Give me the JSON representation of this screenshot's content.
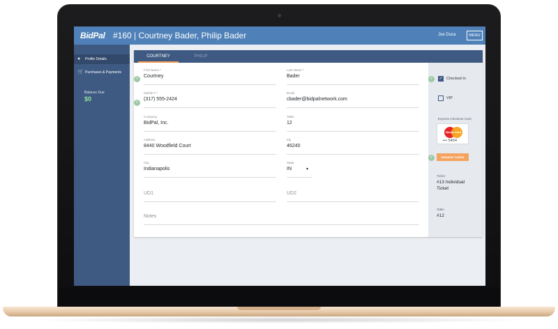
{
  "app": {
    "logo": "BidPal",
    "title": "#160 | Courtney Bader, Philip Bader",
    "user": "Joe Duca",
    "menu_label": "MENU"
  },
  "sidebar": {
    "items": [
      {
        "label": "Profile Details",
        "icon": "person-icon"
      },
      {
        "label": "Purchases & Payments",
        "icon": "cart-icon"
      }
    ],
    "balance_label": "Balance Due",
    "balance_value": "$0"
  },
  "tabs": [
    {
      "label": "COURTNEY"
    },
    {
      "label": "PHILIP"
    }
  ],
  "form": {
    "first_name": {
      "label": "First Name *",
      "value": "Courtney"
    },
    "last_name": {
      "label": "Last Name *",
      "value": "Bader"
    },
    "mobile": {
      "label": "Mobile # *",
      "value": "(317) 555-2424"
    },
    "email": {
      "label": "Email",
      "value": "cbader@bidpalnetwork.com"
    },
    "company": {
      "label": "Company",
      "value": "BidPal, Inc."
    },
    "table": {
      "label": "Table",
      "value": "12"
    },
    "address": {
      "label": "Address",
      "value": "8440 Woodfield Court"
    },
    "zip": {
      "label": "Zip",
      "value": "46240"
    },
    "city": {
      "label": "City",
      "value": "Indianapolis"
    },
    "state": {
      "label": "State",
      "value": "IN"
    },
    "ud1": {
      "placeholder": "UD1"
    },
    "ud2": {
      "placeholder": "UD2"
    },
    "notes": {
      "placeholder": "Notes"
    }
  },
  "right_panel": {
    "checked_in_label": "Checked In",
    "checked_in": true,
    "vip_label": "VIP",
    "vip": false,
    "express_checkout_label": "Express Checkout Card",
    "card_brand": "MasterCard",
    "card_digits": "••• 5454",
    "manage_cards_label": "MANAGE CARDS",
    "ticket_label": "Ticket",
    "ticket_value": "#13 Individual Ticket",
    "table_label": "Table",
    "table_value": "#12"
  },
  "colors": {
    "header": "#4f81b8",
    "sidebar": "#3f5a82",
    "accent": "#f4a460",
    "success": "#9cc9a6",
    "balance": "#8fe39a"
  }
}
